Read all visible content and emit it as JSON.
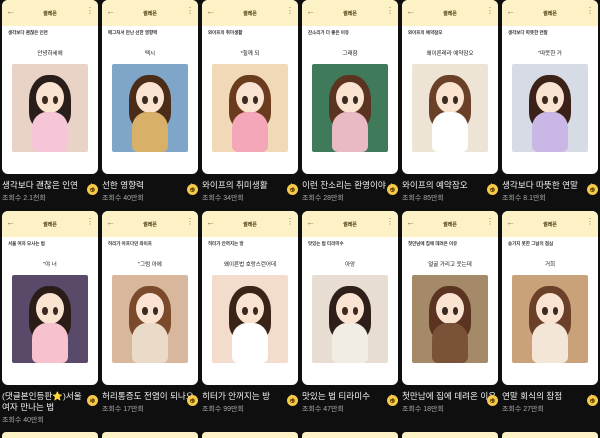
{
  "colors": {
    "background": "#0f0f0f",
    "thumb_header": "#fdf1c6",
    "title_text": "#f1f1f1",
    "meta_text": "#aaaaaa"
  },
  "cards": [
    {
      "channel": "썰레몬",
      "post_title": "생각보다 괜찮은 인연",
      "caption": "안녕하세에",
      "title": "생각보다 괜찮은 인연",
      "views": "조회수 2.1천회",
      "art": {
        "bg": "#e9d2c6",
        "hair": "#2a1e1a",
        "body": "#f6c6d8"
      }
    },
    {
      "channel": "썰레몬",
      "post_title": "매그처서 만난 선한 영향력",
      "caption": "택시",
      "title": "선한 영향력",
      "views": "조회수 40만회",
      "art": {
        "bg": "#7fa6c9",
        "hair": "#4a2c18",
        "body": "#d8b06a"
      }
    },
    {
      "channel": "썰레몬",
      "post_title": "와이프의 취미생활",
      "caption": "*힐께 되",
      "title": "와이프의 취미생활",
      "views": "조회수 34만회",
      "art": {
        "bg": "#f1d9b8",
        "hair": "#6b3b1e",
        "body": "#f4a7b9"
      }
    },
    {
      "channel": "썰레몬",
      "post_title": "잔소리가 더 좋은 이유",
      "caption": "그래함",
      "title": "이런 잔소리는 환영이야",
      "views": "조회수 28만회",
      "art": {
        "bg": "#3f7a5a",
        "hair": "#5a3420",
        "body": "#e9b9c4"
      }
    },
    {
      "channel": "썰레몬",
      "post_title": "와이프의 예약잠오",
      "caption": "왜이른레라 예약잠오",
      "title": "와이프의 예약잠오",
      "views": "조회수 85만회",
      "art": {
        "bg": "#eee4d6",
        "hair": "#6a4028",
        "body": "#ffffff"
      }
    },
    {
      "channel": "썰레몬",
      "post_title": "생각보다 따뜻한 연말",
      "caption": "\"따뜻한 거",
      "title": "생각보다 따뜻한 연말",
      "views": "조회수 8.1만회",
      "art": {
        "bg": "#d7dbe6",
        "hair": "#3a2218",
        "body": "#c9b7e6"
      }
    },
    {
      "channel": "썰레몬",
      "post_title": "서울 여자 모사는 법",
      "caption": "\"야 너",
      "title": "(댓글본인등판⭐)서울 여자 만나는 법",
      "views": "조회수 40만회",
      "art": {
        "bg": "#5a4a6a",
        "hair": "#2b1c18",
        "body": "#f7c2ce"
      }
    },
    {
      "channel": "썰레몬",
      "post_title": "허리가 아프다던 와이프",
      "caption": "\"그럼 아에",
      "title": "허리통증도 전염이 되나요",
      "views": "조회수 17만회",
      "art": {
        "bg": "#d9b79d",
        "hair": "#7a4a2a",
        "body": "#eadbc8"
      }
    },
    {
      "channel": "썰레몬",
      "post_title": "히터가 안꺼지는 방",
      "caption": "왜이른법 호랑스런어데",
      "title": "히터가 안꺼지는 방",
      "views": "조회수 99만회",
      "art": {
        "bg": "#f3dccb",
        "hair": "#3a2418",
        "body": "#ffffff"
      }
    },
    {
      "channel": "썰레몬",
      "post_title": "맛있는 법 티라미수",
      "caption": "아앙",
      "title": "맛있는 법 티라미수",
      "views": "조회수 47만회",
      "art": {
        "bg": "#e7ddd2",
        "hair": "#2e1f1a",
        "body": "#f1ece4"
      }
    },
    {
      "channel": "썰레몬",
      "post_title": "첫만남에 집에 데려온 이유",
      "caption": "얼굴 가리고 웃는데",
      "title": "첫만남에 집에 데려온 이유",
      "views": "조회수 18만회",
      "art": {
        "bg": "#a58a6a",
        "hair": "#5a3420",
        "body": "#7a5238"
      }
    },
    {
      "channel": "썰레몬",
      "post_title": "송가지 못한 그날의 점심",
      "caption": "거희",
      "title": "연말 회식의 참점",
      "views": "조회수 27만회",
      "art": {
        "bg": "#c9a27a",
        "hair": "#6b4028",
        "body": "#f3e6d6"
      }
    }
  ]
}
